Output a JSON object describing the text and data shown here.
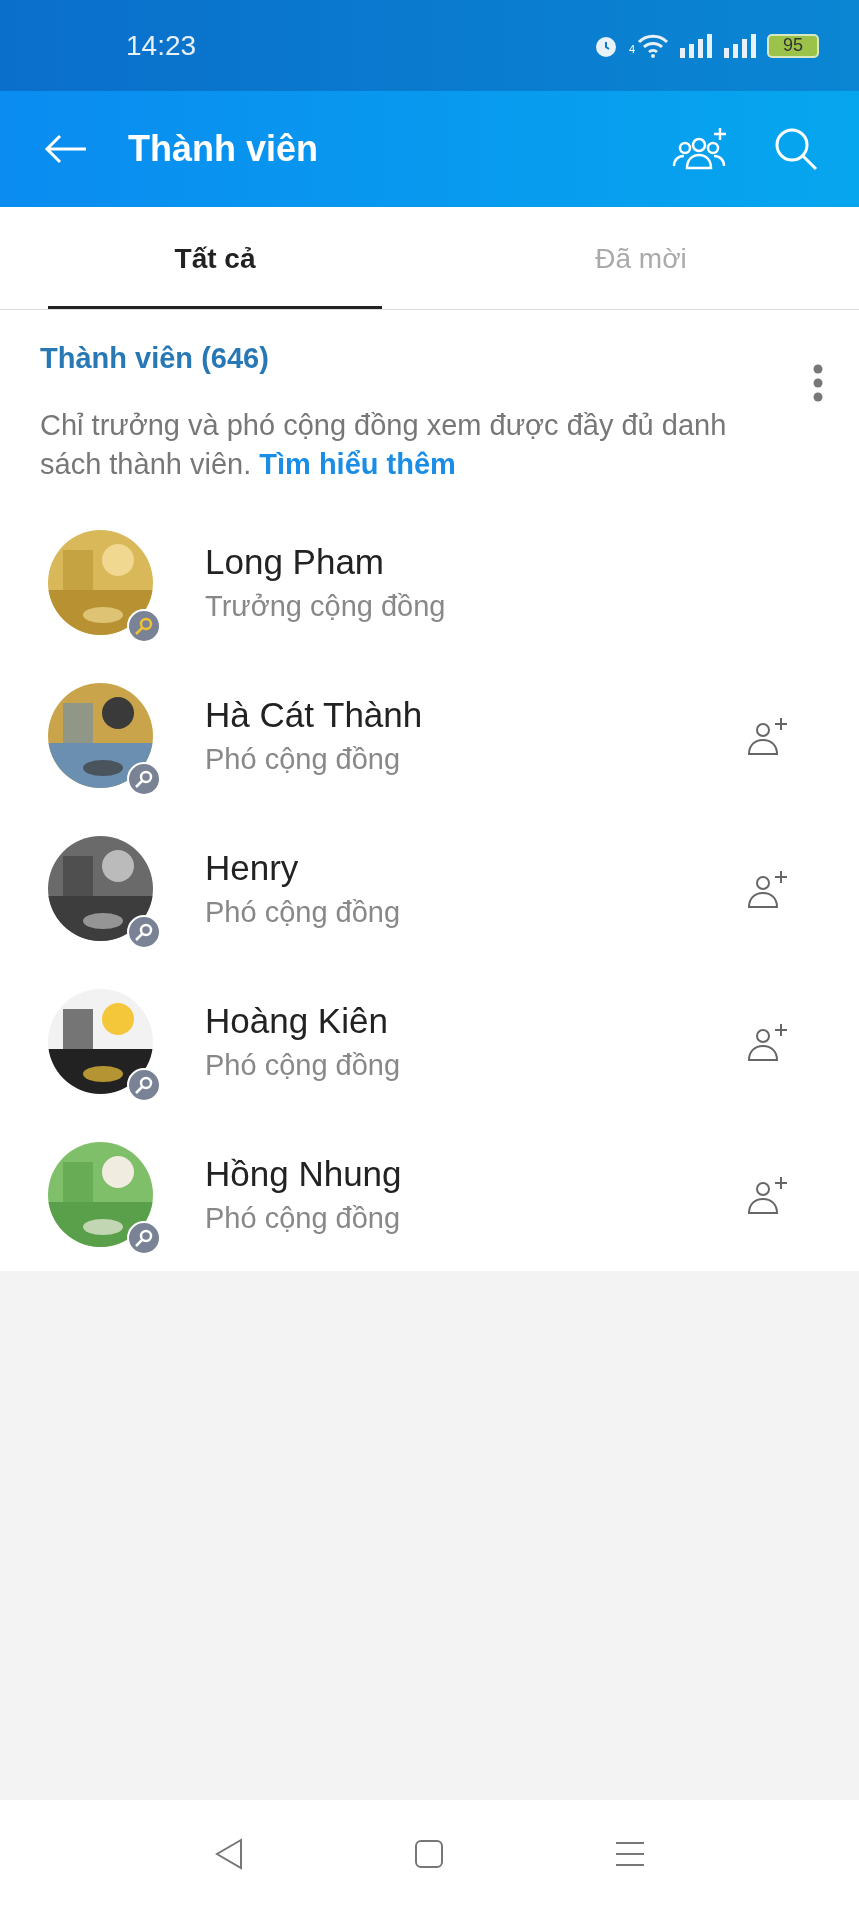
{
  "status_bar": {
    "time": "14:23",
    "battery": "95",
    "network": "4"
  },
  "header": {
    "title": "Thành viên"
  },
  "tabs": [
    {
      "label": "Tất cả",
      "selected": true
    },
    {
      "label": "Đã mời",
      "selected": false
    }
  ],
  "section": {
    "title": "Thành viên (646)",
    "description": "Chỉ trưởng và phó cộng đồng xem được đầy đủ danh sách thành viên.",
    "link": "Tìm hiểu thêm"
  },
  "members": [
    {
      "name": "Long Pham",
      "role": "Trưởng cộng đồng",
      "kind": "leader",
      "can_add": false
    },
    {
      "name": "Hà Cát Thành",
      "role": "Phó cộng đồng",
      "kind": "deputy",
      "can_add": true
    },
    {
      "name": "Henry",
      "role": "Phó cộng đồng",
      "kind": "deputy",
      "can_add": true
    },
    {
      "name": "Hoàng Kiên",
      "role": "Phó cộng đồng",
      "kind": "deputy",
      "can_add": true
    },
    {
      "name": "Hồng Nhung",
      "role": "Phó cộng đồng",
      "kind": "deputy",
      "can_add": true
    }
  ]
}
